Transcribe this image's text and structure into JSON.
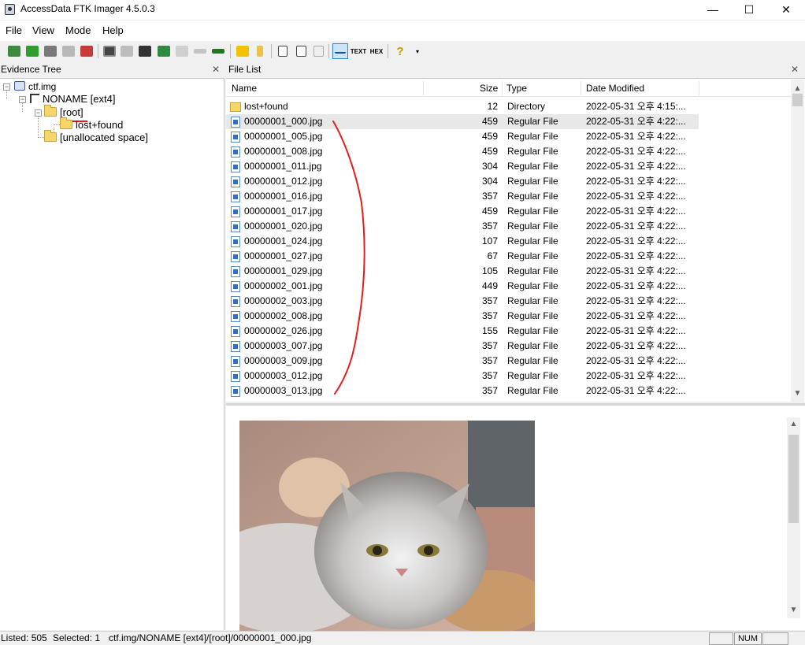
{
  "window": {
    "title": "AccessData FTK Imager 4.5.0.3",
    "minimize": "—",
    "maximize": "☐",
    "close": "✕"
  },
  "menu": [
    {
      "label": "File"
    },
    {
      "label": "View"
    },
    {
      "label": "Mode"
    },
    {
      "label": "Help"
    }
  ],
  "toolbar": {
    "icons": [
      "add-evidence-icon",
      "add-all-evidence-icon",
      "image-mounting-icon",
      "remove-evidence-icon",
      "remove-all-evidence-icon",
      "create-disk-image-icon",
      "export-disk-image-icon",
      "export-logical-image-icon",
      "capture-memory-icon",
      "detect-efs-icon",
      "obtain-protected-files-icon",
      "verify-drive-icon",
      "export-files-icon",
      "export-hash-list-icon",
      "new-document-icon",
      "properties-icon",
      "hex-value-icon",
      "auto-view-icon",
      "text-view-icon",
      "hex-view-icon",
      "help-icon"
    ],
    "text_label": "TEXT",
    "hex_label": "HEX",
    "help_label": "?"
  },
  "evidence_tree": {
    "title": "Evidence Tree",
    "close": "✕",
    "nodes": [
      {
        "label": "ctf.img"
      },
      {
        "label": "NONAME [ext4]"
      },
      {
        "label": "[root]"
      },
      {
        "label": "lost+found"
      },
      {
        "label": "[unallocated space]"
      }
    ]
  },
  "file_list": {
    "title": "File List",
    "close": "✕",
    "columns": {
      "name": "Name",
      "size": "Size",
      "type": "Type",
      "date": "Date Modified"
    },
    "rows": [
      {
        "name": "lost+found",
        "size": "12",
        "type": "Directory",
        "date": "2022-05-31 오후 4:15:..."
      },
      {
        "name": "00000001_000.jpg",
        "size": "459",
        "type": "Regular File",
        "date": "2022-05-31 오후 4:22:..."
      },
      {
        "name": "00000001_005.jpg",
        "size": "459",
        "type": "Regular File",
        "date": "2022-05-31 오후 4:22:..."
      },
      {
        "name": "00000001_008.jpg",
        "size": "459",
        "type": "Regular File",
        "date": "2022-05-31 오후 4:22:..."
      },
      {
        "name": "00000001_011.jpg",
        "size": "304",
        "type": "Regular File",
        "date": "2022-05-31 오후 4:22:..."
      },
      {
        "name": "00000001_012.jpg",
        "size": "304",
        "type": "Regular File",
        "date": "2022-05-31 오후 4:22:..."
      },
      {
        "name": "00000001_016.jpg",
        "size": "357",
        "type": "Regular File",
        "date": "2022-05-31 오후 4:22:..."
      },
      {
        "name": "00000001_017.jpg",
        "size": "459",
        "type": "Regular File",
        "date": "2022-05-31 오후 4:22:..."
      },
      {
        "name": "00000001_020.jpg",
        "size": "357",
        "type": "Regular File",
        "date": "2022-05-31 오후 4:22:..."
      },
      {
        "name": "00000001_024.jpg",
        "size": "107",
        "type": "Regular File",
        "date": "2022-05-31 오후 4:22:..."
      },
      {
        "name": "00000001_027.jpg",
        "size": "67",
        "type": "Regular File",
        "date": "2022-05-31 오후 4:22:..."
      },
      {
        "name": "00000001_029.jpg",
        "size": "105",
        "type": "Regular File",
        "date": "2022-05-31 오후 4:22:..."
      },
      {
        "name": "00000002_001.jpg",
        "size": "449",
        "type": "Regular File",
        "date": "2022-05-31 오후 4:22:..."
      },
      {
        "name": "00000002_003.jpg",
        "size": "357",
        "type": "Regular File",
        "date": "2022-05-31 오후 4:22:..."
      },
      {
        "name": "00000002_008.jpg",
        "size": "357",
        "type": "Regular File",
        "date": "2022-05-31 오후 4:22:..."
      },
      {
        "name": "00000002_026.jpg",
        "size": "155",
        "type": "Regular File",
        "date": "2022-05-31 오후 4:22:..."
      },
      {
        "name": "00000003_007.jpg",
        "size": "357",
        "type": "Regular File",
        "date": "2022-05-31 오후 4:22:..."
      },
      {
        "name": "00000003_009.jpg",
        "size": "357",
        "type": "Regular File",
        "date": "2022-05-31 오후 4:22:..."
      },
      {
        "name": "00000003_012.jpg",
        "size": "357",
        "type": "Regular File",
        "date": "2022-05-31 오후 4:22:..."
      },
      {
        "name": "00000003_013.jpg",
        "size": "357",
        "type": "Regular File",
        "date": "2022-05-31 오후 4:22:..."
      }
    ]
  },
  "status": {
    "listed": "Listed: 505",
    "selected": "Selected: 1",
    "path": "ctf.img/NONAME [ext4]/[root]/00000001_000.jpg",
    "num": "NUM"
  },
  "colors": {
    "annotation": "#e02020",
    "selection": "#e8e8e8",
    "toolbar_active": "#cce4f7"
  }
}
